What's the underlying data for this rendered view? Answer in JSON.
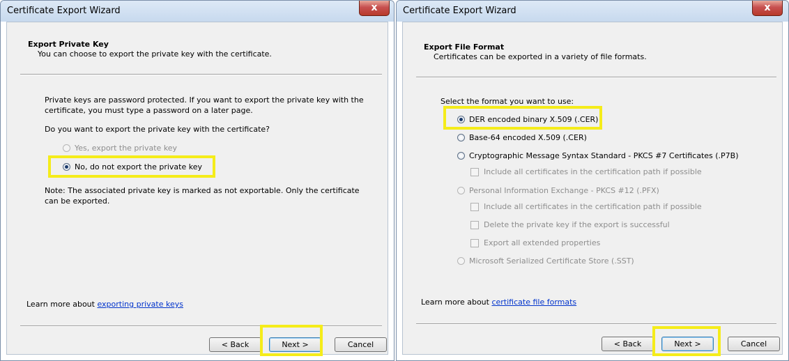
{
  "left_window": {
    "title": "Certificate Export Wizard",
    "close_label": "x",
    "header": {
      "title": "Export Private Key",
      "subtitle": "You can choose to export the private key with the certificate."
    },
    "body": {
      "paragraph_line1": "Private keys are password protected. If you want to export the private key with the",
      "paragraph_line2": "certificate, you must type a password on a later page.",
      "question": "Do you want to export the private key with the certificate?",
      "options": [
        {
          "label": "Yes, export the private key",
          "selected": false,
          "enabled": false
        },
        {
          "label": "No, do not export the private key",
          "selected": true,
          "enabled": true
        }
      ],
      "note_line1": "Note: The associated private key is marked as not exportable. Only the certificate",
      "note_line2": "can be exported."
    },
    "learn_more": {
      "prefix": "Learn more about ",
      "link": "exporting private keys"
    },
    "buttons": {
      "back": "< Back",
      "next": "Next >",
      "cancel": "Cancel"
    }
  },
  "right_window": {
    "title": "Certificate Export Wizard",
    "close_label": "x",
    "header": {
      "title": "Export File Format",
      "subtitle": "Certificates can be exported in a variety of file formats."
    },
    "body": {
      "prompt": "Select the format you want to use:",
      "formats": [
        {
          "label": "DER encoded binary X.509 (.CER)",
          "selected": true,
          "enabled": true
        },
        {
          "label": "Base-64 encoded X.509 (.CER)",
          "selected": false,
          "enabled": true
        },
        {
          "label": "Cryptographic Message Syntax Standard - PKCS #7 Certificates (.P7B)",
          "selected": false,
          "enabled": true
        },
        {
          "label": "Personal Information Exchange - PKCS #12 (.PFX)",
          "selected": false,
          "enabled": false
        },
        {
          "label": "Microsoft Serialized Certificate Store (.SST)",
          "selected": false,
          "enabled": false
        }
      ],
      "checkboxes": [
        {
          "label": "Include all certificates in the certification path if possible",
          "checked": false,
          "enabled": false
        },
        {
          "label": "Include all certificates in the certification path if possible",
          "checked": false,
          "enabled": false
        },
        {
          "label": "Delete the private key if the export is successful",
          "checked": false,
          "enabled": false
        },
        {
          "label": "Export all extended properties",
          "checked": false,
          "enabled": false
        }
      ]
    },
    "learn_more": {
      "prefix": "Learn more about ",
      "link": "certificate file formats"
    },
    "buttons": {
      "back": "< Back",
      "next": "Next >",
      "cancel": "Cancel"
    }
  },
  "highlight_color": "#f5ec1a"
}
